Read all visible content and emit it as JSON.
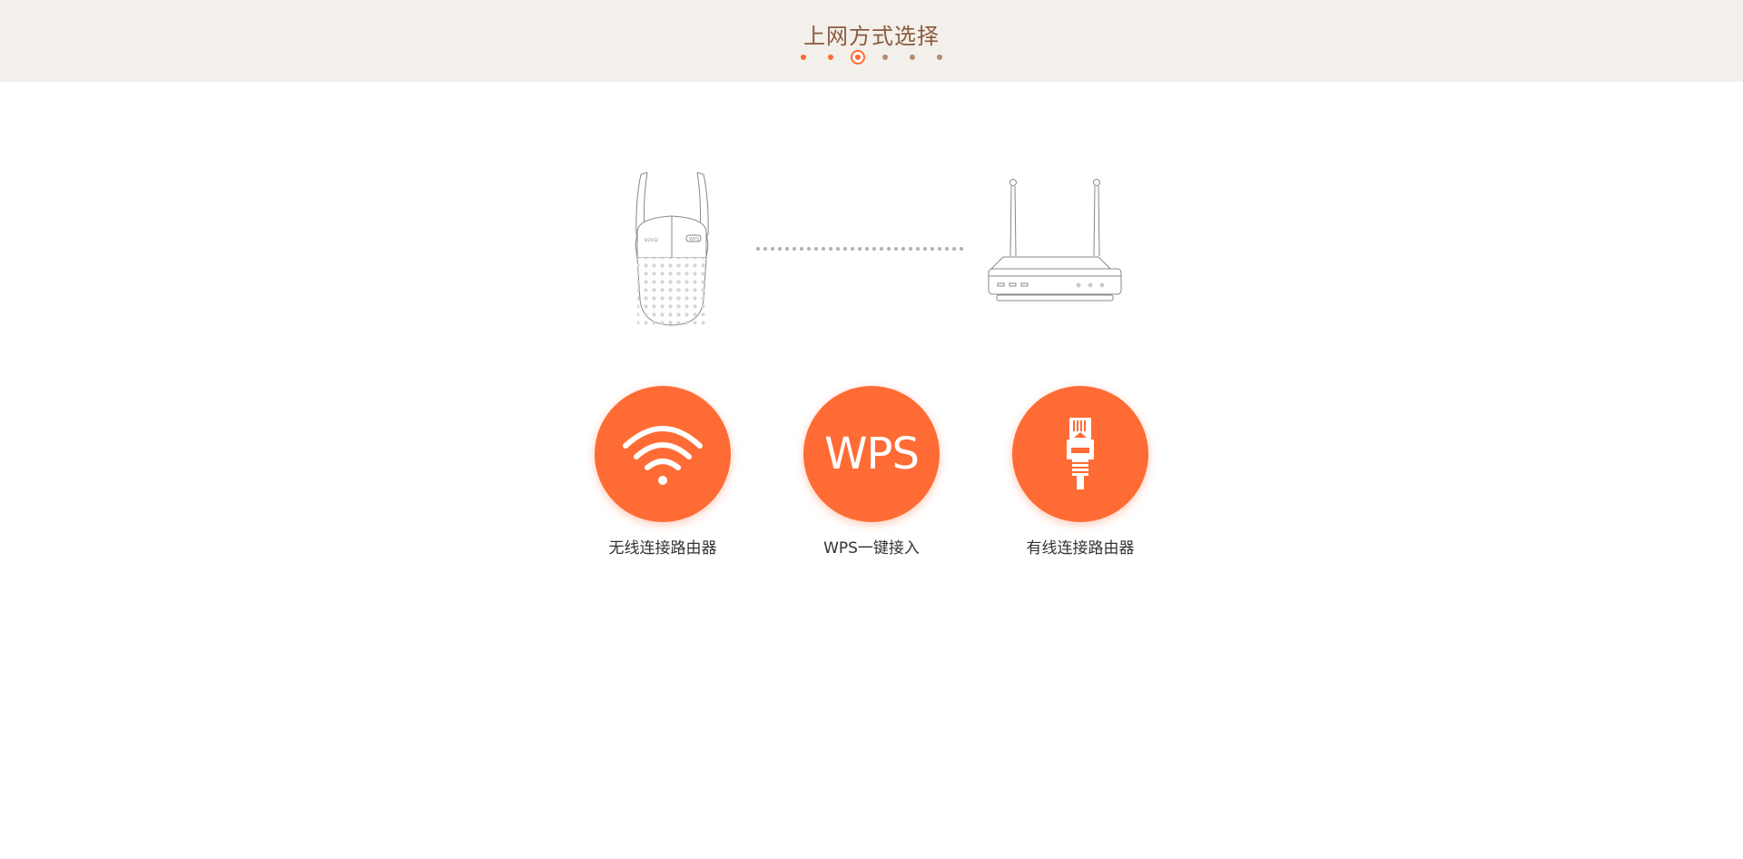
{
  "header": {
    "title": "上网方式选择",
    "steps_total": 6,
    "steps_completed": 2,
    "current_step": 3
  },
  "illustration": {
    "repeater_brand": "ezviz",
    "repeater_button": "WPS"
  },
  "options": [
    {
      "id": "wireless",
      "label": "无线连接路由器",
      "icon": "wifi-icon"
    },
    {
      "id": "wps",
      "label": "WPS一键接入",
      "icon": "wps-icon",
      "icon_text": "WPS"
    },
    {
      "id": "wired",
      "label": "有线连接路由器",
      "icon": "ethernet-cable-icon"
    }
  ],
  "colors": {
    "accent": "#ff6b35",
    "header_bg": "#f3efea",
    "title": "#8a5a3e",
    "step_inactive": "#b68a6e"
  }
}
